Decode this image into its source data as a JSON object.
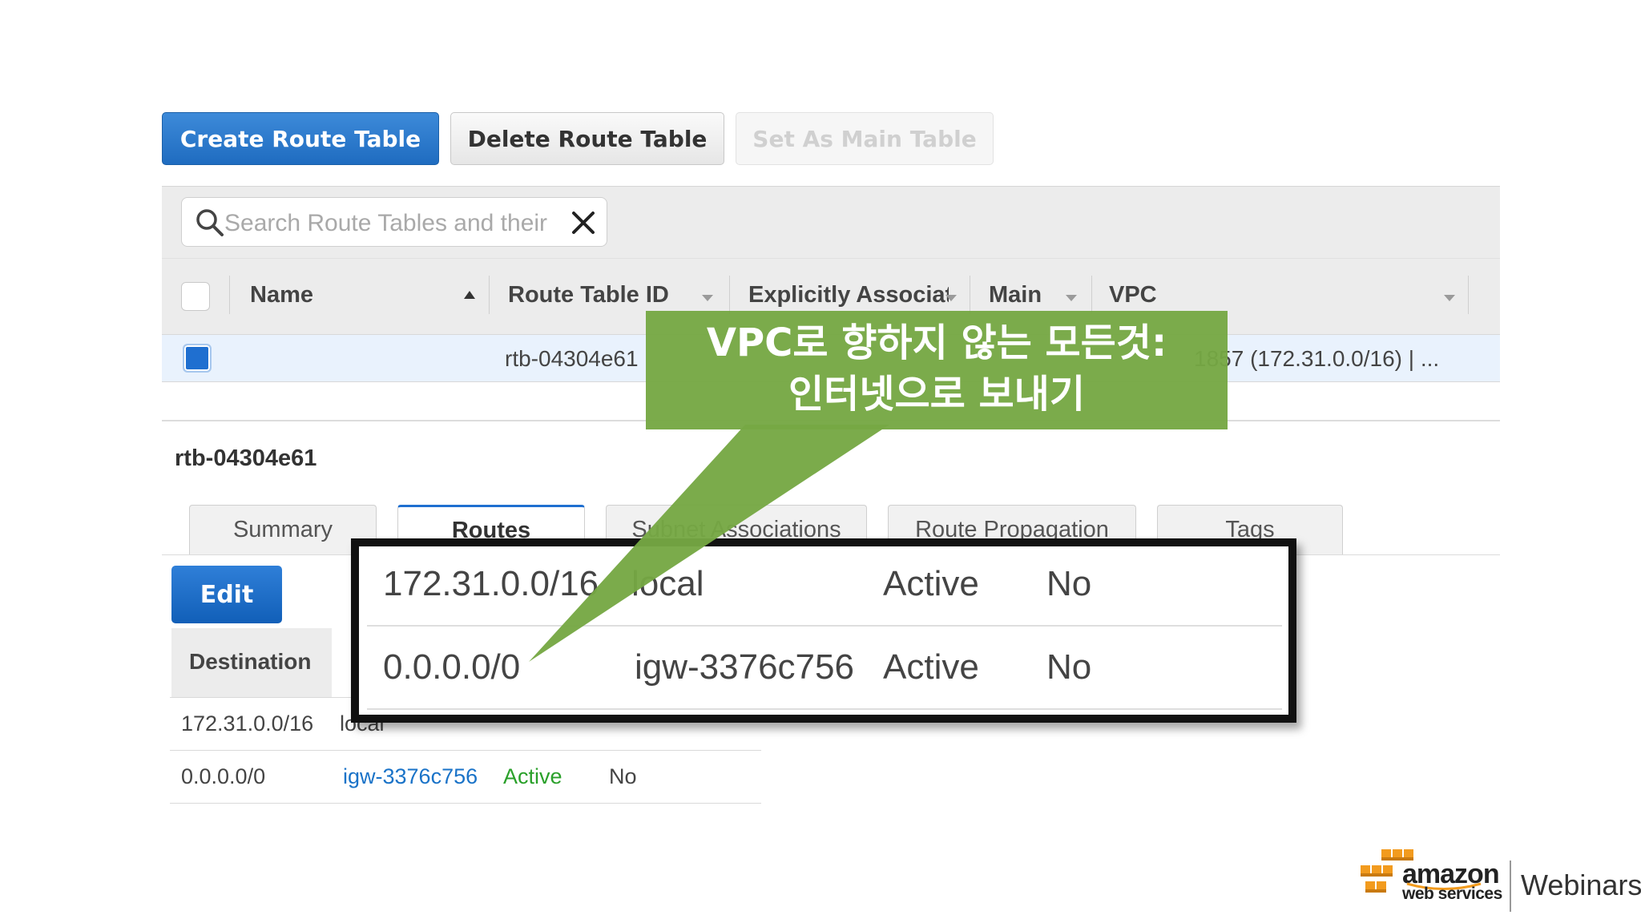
{
  "toolbar": {
    "create_label": "Create Route Table",
    "delete_label": "Delete Route Table",
    "set_main_label": "Set As Main Table"
  },
  "search": {
    "placeholder": "Search Route Tables and their"
  },
  "table": {
    "columns": [
      "Name",
      "Route Table ID",
      "Explicitly Associat",
      "Main",
      "VPC"
    ],
    "selected_row": {
      "route_table_id": "rtb-04304e61",
      "vpc_fragment": "1857 (172.31.0.0/16) | ..."
    }
  },
  "detail": {
    "title": "rtb-04304e61",
    "tabs": [
      "Summary",
      "Routes",
      "Subnet Associations",
      "Route Propagation",
      "Tags"
    ],
    "active_tab": "Routes",
    "edit_label": "Edit",
    "destination_header": "Destination",
    "routes": [
      {
        "destination": "172.31.0.0/16",
        "target": "local",
        "status": "Active",
        "propagated": "No"
      },
      {
        "destination": "0.0.0.0/0",
        "target": "igw-3376c756",
        "status": "Active",
        "propagated": "No"
      }
    ]
  },
  "callout": {
    "line1": "VPC로 향하지 않는 모든것:",
    "line2": "인터넷으로 보내기"
  },
  "logo": {
    "brand": "amazon",
    "sub": "web services",
    "product": "Webinars"
  },
  "colors": {
    "primary_button": "#1f6cc0",
    "callout_green": "#76a844",
    "active_green": "#2aa02a",
    "link_blue": "#1a73c8",
    "logo_orange": "#f29b1e"
  }
}
